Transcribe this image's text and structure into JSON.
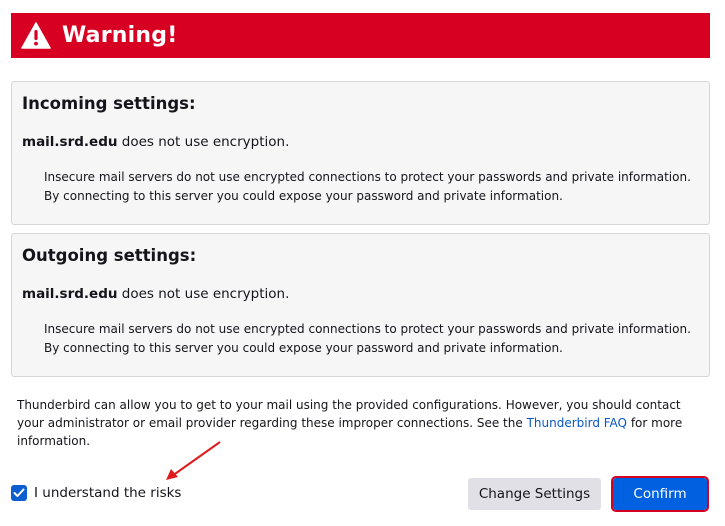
{
  "warning": {
    "title": "Warning!",
    "icon": "warning-triangle-icon"
  },
  "incoming": {
    "heading": "Incoming settings:",
    "server": "mail.srd.edu",
    "server_suffix": " does not use encryption.",
    "description": "Insecure mail servers do not use encrypted connections to protect your passwords and private information. By connecting to this server you could expose your password and private information."
  },
  "outgoing": {
    "heading": "Outgoing settings:",
    "server": "mail.srd.edu",
    "server_suffix": " does not use encryption.",
    "description": "Insecure mail servers do not use encrypted connections to protect your passwords and private information. By connecting to this server you could expose your password and private information."
  },
  "info": {
    "text_before": "Thunderbird can allow you to get to your mail using the provided configurations. However, you should contact your administrator or email provider regarding these improper connections. See the ",
    "link": "Thunderbird FAQ",
    "text_after": " for more information."
  },
  "acknowledge": {
    "label": "I understand the risks",
    "checked": true
  },
  "buttons": {
    "change_settings": "Change Settings",
    "confirm": "Confirm"
  },
  "colors": {
    "warning_red": "#d70022",
    "accent_blue": "#0061e0",
    "link_blue": "#0b57c4",
    "box_bg": "#f6f6f6"
  }
}
